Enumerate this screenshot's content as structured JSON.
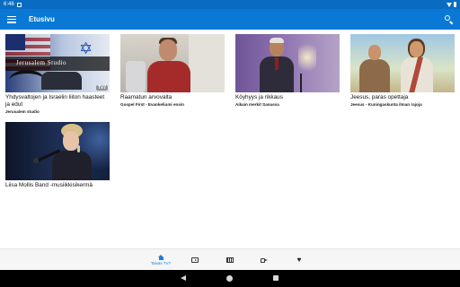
{
  "status_bar": {
    "time": "6:46",
    "icons": [
      "notification-icon",
      "wifi-icon",
      "battery-icon"
    ]
  },
  "app_bar": {
    "title": "Etusivu",
    "menu_icon": "menu-icon",
    "search_icon": "search-icon"
  },
  "cards": [
    {
      "title": "Yhdysvaltojen ja Israelin liiton haasteet ja edut",
      "subtitle": "Jerusalem studio",
      "thumb_text": "Jerusalem Studio",
      "badge": "TV7"
    },
    {
      "title": "Raamatun arvovalta",
      "subtitle": "Gospel First - Evankeliumi ensin"
    },
    {
      "title": "Köyhyys ja rikkaus",
      "subtitle": "Aikain merkit Sanassa"
    },
    {
      "title": "Jeesus, paras opettaja",
      "subtitle": "Jeesus - Kuningaskunta ilman rajoja"
    },
    {
      "title": "Liisa Mollis Band -musiikkisikermä",
      "subtitle": ""
    }
  ],
  "bottom_nav": {
    "items": [
      {
        "label": "Taivas TV7",
        "icon": "home-icon",
        "active": true
      },
      {
        "label": "",
        "icon": "play-icon",
        "active": false
      },
      {
        "label": "",
        "icon": "library-icon",
        "active": false
      },
      {
        "label": "",
        "icon": "video-camera-icon",
        "active": false
      },
      {
        "label": "",
        "icon": "heart-icon",
        "active": false
      }
    ]
  },
  "colors": {
    "app_bar": "#0a79d6",
    "status_bar": "#0a6cc0",
    "accent": "#1a7fd4"
  },
  "heart_glyph": "♥"
}
